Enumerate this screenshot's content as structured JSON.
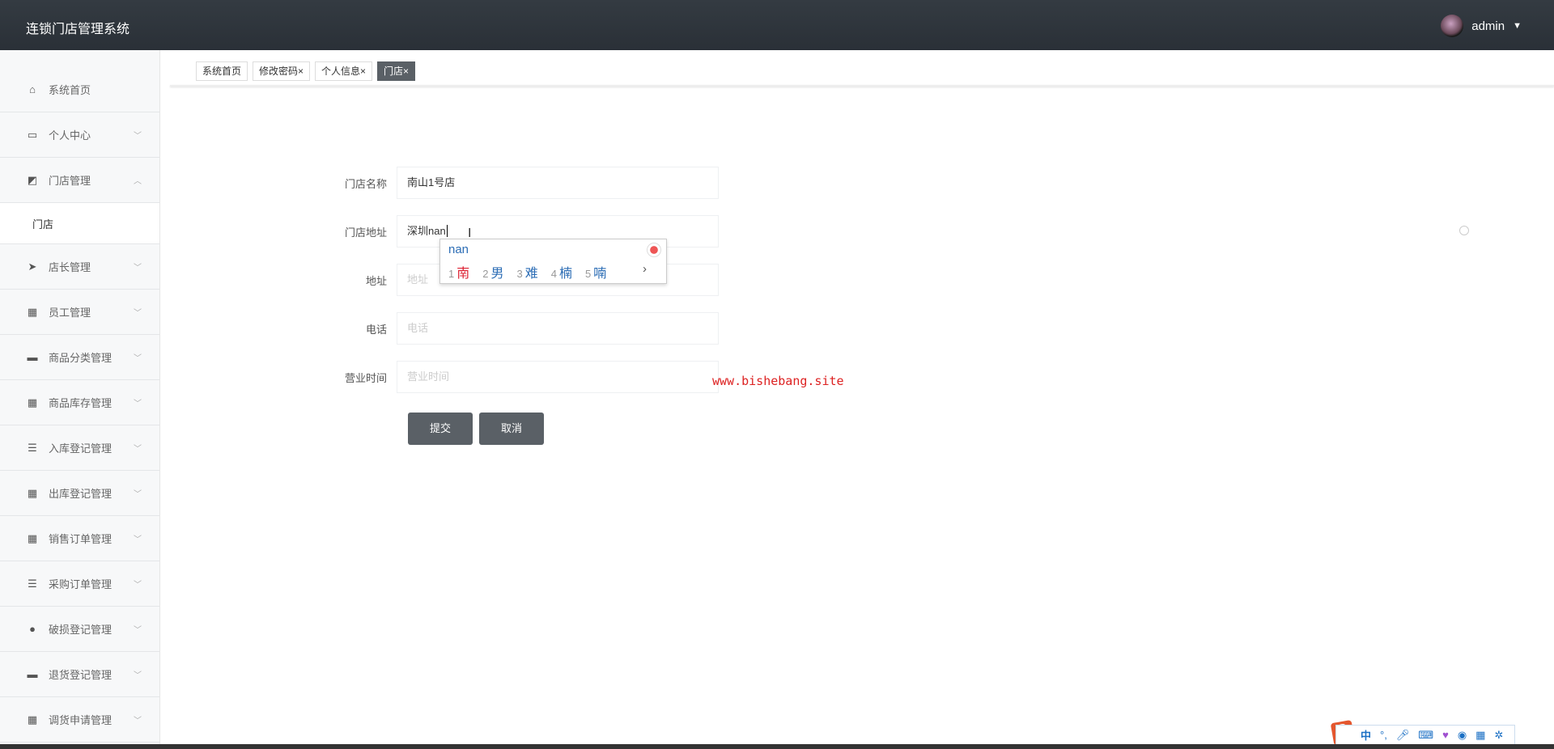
{
  "header": {
    "title": "连锁门店管理系统",
    "user": "admin"
  },
  "sidebar": {
    "items": [
      {
        "label": "系统首页",
        "icon": "home-icon",
        "glyph": "⌂",
        "chev": ""
      },
      {
        "label": "个人中心",
        "icon": "card-icon",
        "glyph": "▭",
        "chev": "﹀"
      },
      {
        "label": "门店管理",
        "icon": "chart-icon",
        "glyph": "◩",
        "chev": "︿"
      }
    ],
    "sub": "门店",
    "items2": [
      {
        "label": "店长管理",
        "icon": "send-icon",
        "glyph": "➤"
      },
      {
        "label": "员工管理",
        "icon": "grid-icon",
        "glyph": "▦"
      },
      {
        "label": "商品分类管理",
        "icon": "monitor-icon",
        "glyph": "▬"
      },
      {
        "label": "商品库存管理",
        "icon": "apps-icon",
        "glyph": "▦"
      },
      {
        "label": "入库登记管理",
        "icon": "sliders-icon",
        "glyph": "☰"
      },
      {
        "label": "出库登记管理",
        "icon": "apps-icon",
        "glyph": "▦"
      },
      {
        "label": "销售订单管理",
        "icon": "apps-icon",
        "glyph": "▦"
      },
      {
        "label": "采购订单管理",
        "icon": "list-icon",
        "glyph": "☰"
      },
      {
        "label": "破损登记管理",
        "icon": "user-icon",
        "glyph": "●"
      },
      {
        "label": "退货登记管理",
        "icon": "box-icon",
        "glyph": "▬"
      },
      {
        "label": "调货申请管理",
        "icon": "apps-icon",
        "glyph": "▦"
      }
    ],
    "chev": "﹀"
  },
  "tabs": [
    {
      "label": "系统首页"
    },
    {
      "label": "修改密码×"
    },
    {
      "label": "个人信息×"
    },
    {
      "label": "门店×"
    }
  ],
  "form": {
    "name_label": "门店名称",
    "name_value": "南山1号店",
    "addr_label": "门店地址",
    "addr_value": "深圳nan",
    "address_label": "地址",
    "address_placeholder": "地址",
    "phone_label": "电话",
    "phone_placeholder": "电话",
    "hours_label": "营业时间",
    "hours_placeholder": "营业时间",
    "submit": "提交",
    "cancel": "取消"
  },
  "ime": {
    "pinyin": "nan",
    "candidates": [
      {
        "n": "1",
        "c": "南"
      },
      {
        "n": "2",
        "c": "男"
      },
      {
        "n": "3",
        "c": "难"
      },
      {
        "n": "4",
        "c": "楠"
      },
      {
        "n": "5",
        "c": "喃"
      }
    ],
    "next": "›"
  },
  "watermark": "www.bishebang.site",
  "imebar": {
    "logo": "S",
    "mode": "中",
    "punct": "°,"
  }
}
